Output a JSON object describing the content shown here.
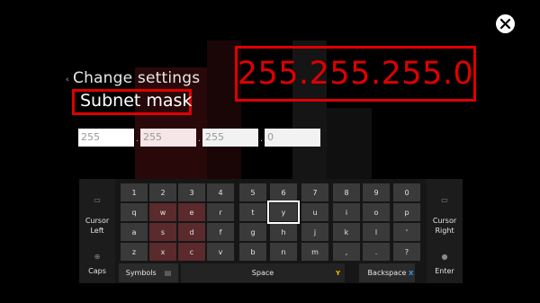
{
  "header": {
    "breadcrumb": "Change settings",
    "title": "Subnet mask"
  },
  "overlay_value": "255.255.255.0",
  "ip_fields": {
    "octet1": "255",
    "octet2": "255",
    "octet3": "255",
    "octet4": "0",
    "separator": "."
  },
  "keyboard": {
    "row1": [
      "1",
      "2",
      "3",
      "4",
      "5",
      "6",
      "7",
      "8",
      "9",
      "0"
    ],
    "row2": [
      "q",
      "w",
      "e",
      "r",
      "t",
      "y",
      "u",
      "i",
      "o",
      "p"
    ],
    "row3": [
      "a",
      "s",
      "d",
      "f",
      "g",
      "h",
      "j",
      "k",
      "l",
      "'"
    ],
    "row4": [
      "z",
      "x",
      "c",
      "v",
      "b",
      "n",
      "m",
      ",",
      ".",
      "?"
    ],
    "selected_key": "y",
    "cursor_left": "Cursor\nLeft",
    "cursor_right": "Cursor\nRight",
    "caps": "Caps",
    "symbols": "Symbols",
    "space": "Space",
    "backspace": "Backspace",
    "enter": "Enter",
    "hint_y": "Y",
    "hint_x": "X"
  },
  "colors": {
    "highlight_red": "#e00000",
    "background": "#000000"
  },
  "icons": [
    "xbox-logo-icon",
    "left-bumper-icon",
    "right-bumper-icon",
    "left-stick-icon",
    "right-stick-icon",
    "view-icon"
  ]
}
